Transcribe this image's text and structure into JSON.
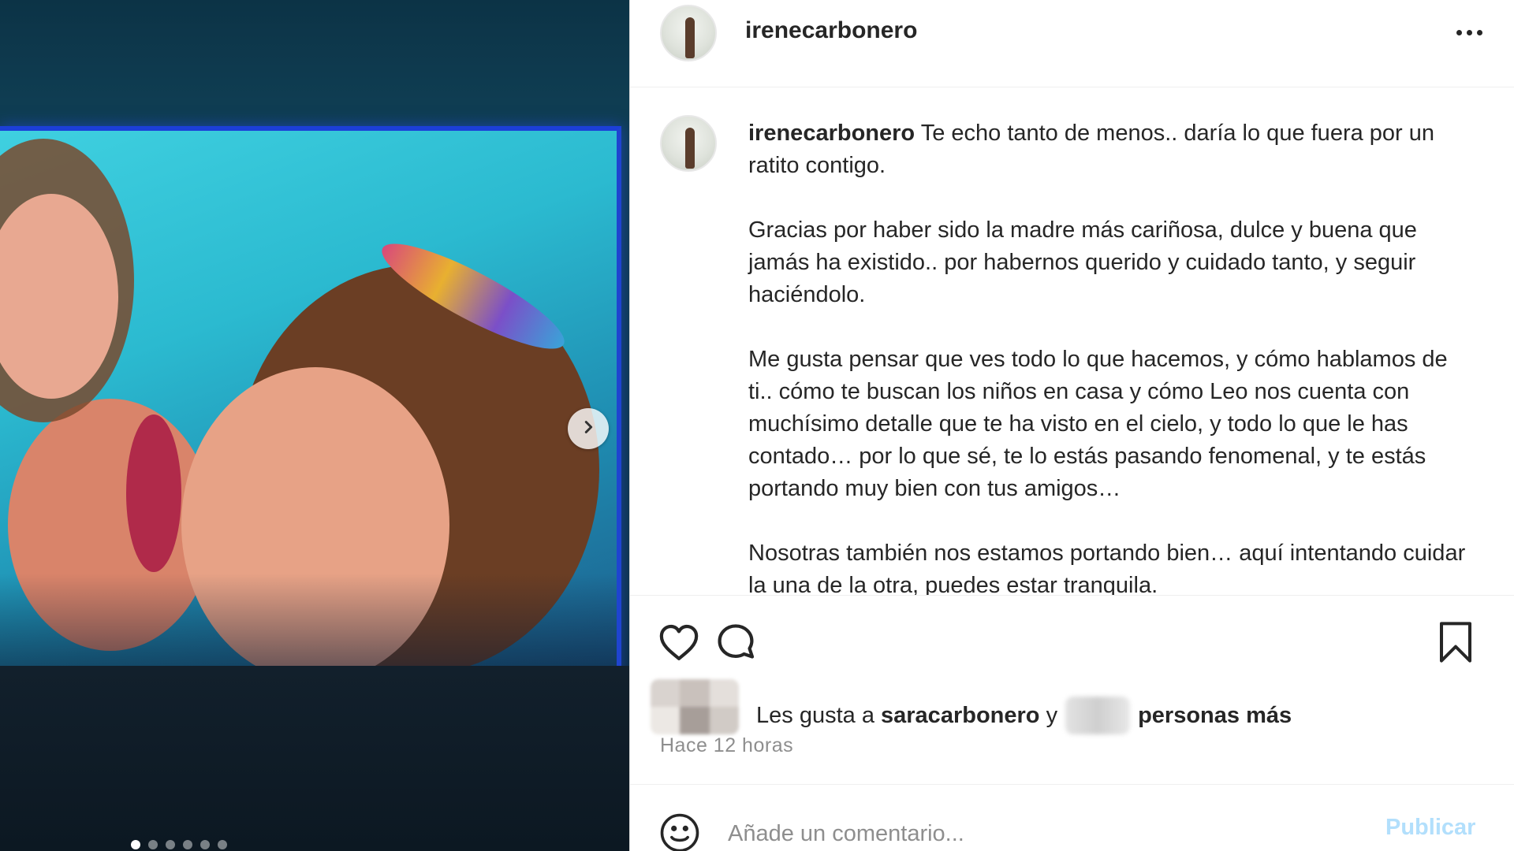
{
  "post": {
    "username": "irenecarbonero",
    "more_icon": "more-horizontal-icon",
    "caption": {
      "username": "irenecarbonero",
      "paragraph_1": "Te echo tanto de menos.. daría lo que fuera por un ratito contigo.",
      "paragraph_2": "Gracias por haber sido la madre más cariñosa, dulce y buena que jamás ha existido.. por habernos querido y cuidado tanto, y seguir haciéndolo.",
      "paragraph_3": "Me gusta pensar que ves todo lo que hacemos, y cómo hablamos de ti.. cómo te buscan los niños en casa y cómo Leo nos cuenta con muchísimo detalle que te ha visto en el cielo, y todo lo que le has contado… por lo que sé, te lo estás pasando fenomenal, y te estás portando muy bien con tus amigos…",
      "paragraph_4": "Nosotras también nos estamos portando bien… aquí intentando cuidar la una de la otra, puedes estar tranquila."
    },
    "likes": {
      "prefix": "Les gusta a",
      "user": "saracarbonero",
      "conjunction": "y",
      "suffix": "personas más"
    },
    "time_ago": "Hace 12 horas",
    "comment": {
      "placeholder": "Añade un comentario...",
      "value": "",
      "publish_label": "Publicar"
    }
  },
  "carousel": {
    "total_slides": 6,
    "active_slide": 1
  },
  "icons": {
    "like": "heart-icon",
    "comment": "comment-bubble-icon",
    "save": "bookmark-icon",
    "emoji": "smiley-icon",
    "next": "chevron-right-icon"
  },
  "colors": {
    "text": "#262626",
    "secondary_text": "#8e8e8e",
    "publish_disabled": "#b2dffc",
    "divider": "#efefef"
  }
}
